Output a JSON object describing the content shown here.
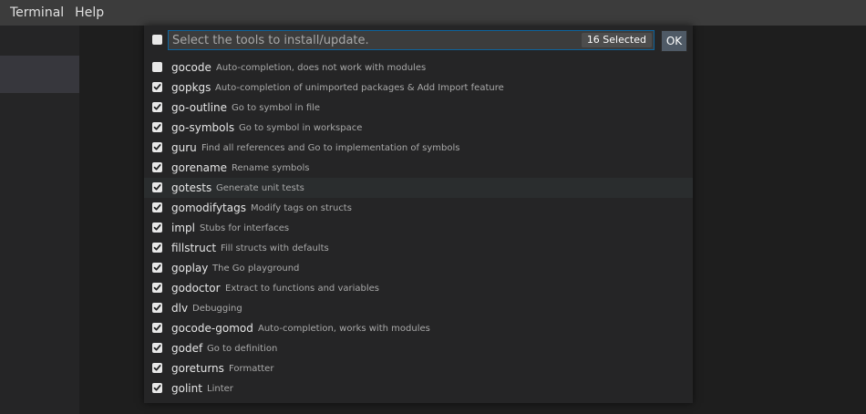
{
  "menubar": {
    "items": [
      {
        "label": "Terminal"
      },
      {
        "label": "Help"
      }
    ]
  },
  "quickpick": {
    "placeholder": "Select the tools to install/update.",
    "value": "",
    "count": "16 Selected",
    "ok_label": "OK",
    "select_all_checked": false,
    "items": [
      {
        "name": "gocode",
        "description": "Auto-completion, does not work with modules",
        "checked": false
      },
      {
        "name": "gopkgs",
        "description": "Auto-completion of unimported packages & Add Import feature",
        "checked": true
      },
      {
        "name": "go-outline",
        "description": "Go to symbol in file",
        "checked": true
      },
      {
        "name": "go-symbols",
        "description": "Go to symbol in workspace",
        "checked": true
      },
      {
        "name": "guru",
        "description": "Find all references and Go to implementation of symbols",
        "checked": true
      },
      {
        "name": "gorename",
        "description": "Rename symbols",
        "checked": true
      },
      {
        "name": "gotests",
        "description": "Generate unit tests",
        "checked": true
      },
      {
        "name": "gomodifytags",
        "description": "Modify tags on structs",
        "checked": true
      },
      {
        "name": "impl",
        "description": "Stubs for interfaces",
        "checked": true
      },
      {
        "name": "fillstruct",
        "description": "Fill structs with defaults",
        "checked": true
      },
      {
        "name": "goplay",
        "description": "The Go playground",
        "checked": true
      },
      {
        "name": "godoctor",
        "description": "Extract to functions and variables",
        "checked": true
      },
      {
        "name": "dlv",
        "description": "Debugging",
        "checked": true
      },
      {
        "name": "gocode-gomod",
        "description": "Auto-completion, works with modules",
        "checked": true
      },
      {
        "name": "godef",
        "description": "Go to definition",
        "checked": true
      },
      {
        "name": "goreturns",
        "description": "Formatter",
        "checked": true
      },
      {
        "name": "golint",
        "description": "Linter",
        "checked": true
      }
    ]
  }
}
